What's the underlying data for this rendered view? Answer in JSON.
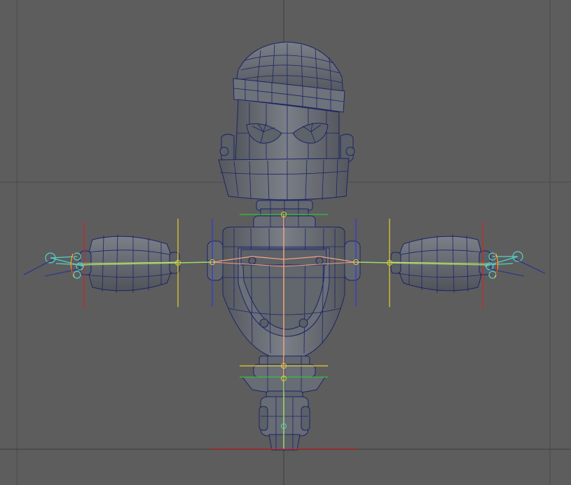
{
  "app": {
    "window_title": ""
  },
  "viewport": {
    "camera": "front",
    "background_color": "#5d5d5d",
    "grid_line_color": "#4a4a4a",
    "mesh_wire_color": "#1f2a6e",
    "mesh_fill_color": "#6a6e75",
    "joint_color_spine": "#f2a27a",
    "joint_color_arm": "#9fd86a",
    "control_color_ik": "#52d2c8",
    "axis_color_x": "#d42424",
    "axis_color_y": "#e6d12a",
    "axis_color_z": "#2f3bd6",
    "axis_color_green": "#33c23a"
  },
  "icons": {
    "joint": "joint-icon",
    "ik_handle": "ik-handle-icon",
    "pivot": "pivot-icon"
  }
}
